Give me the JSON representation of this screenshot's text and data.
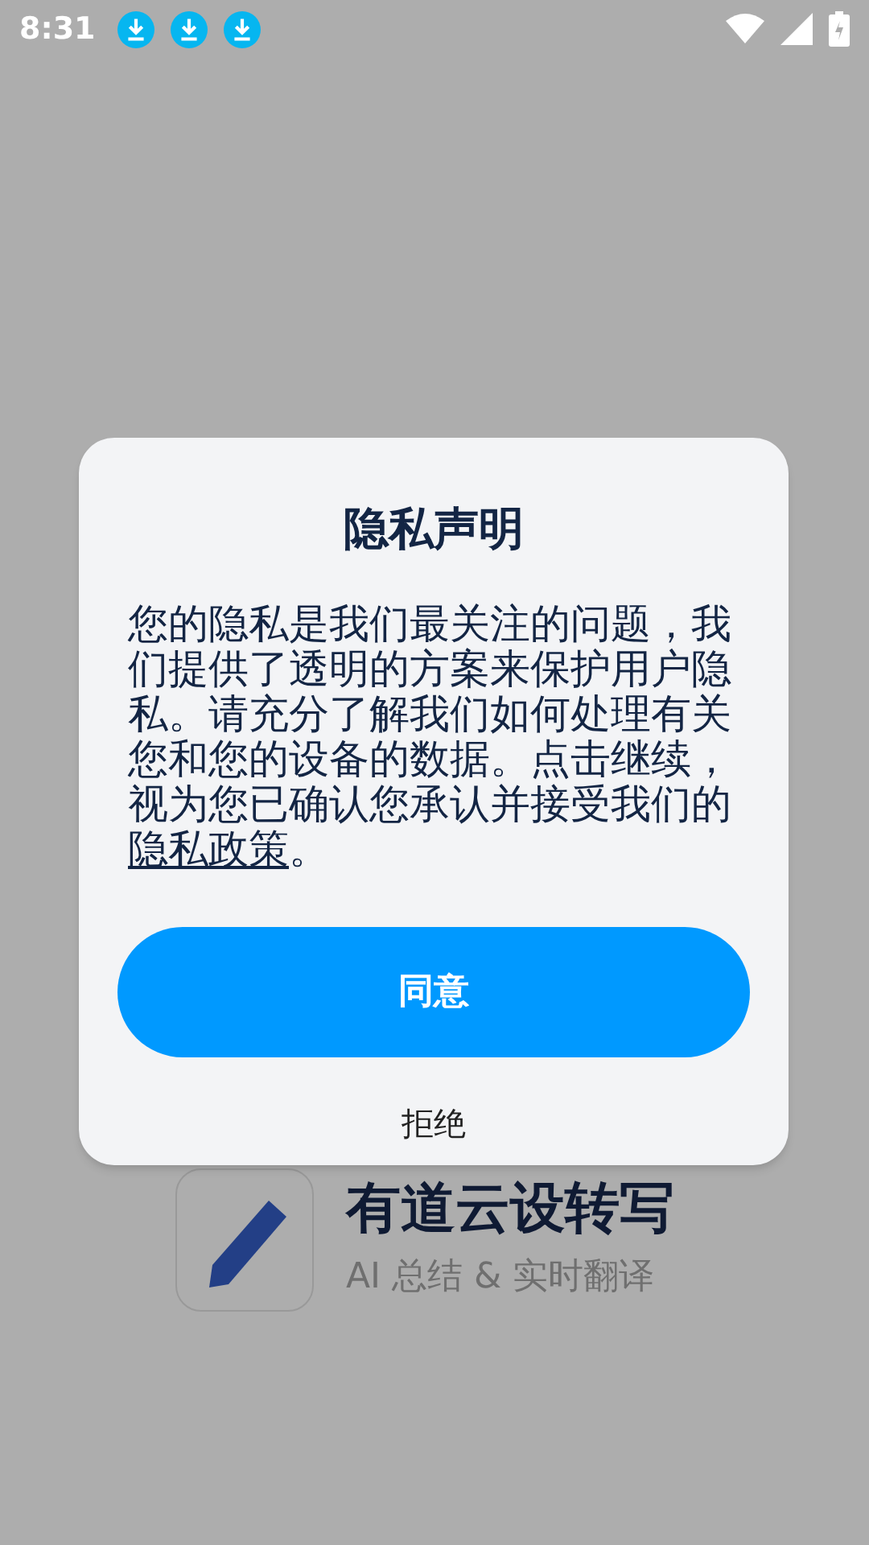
{
  "status_bar": {
    "time": "8:31",
    "notifications": [
      {
        "kind": "download"
      },
      {
        "kind": "download"
      },
      {
        "kind": "download"
      }
    ]
  },
  "background_app": {
    "title": "有道云设转写",
    "subtitle": "AI 总结 & 实时翻译"
  },
  "dialog": {
    "title": "隐私声明",
    "body": "您的隐私是我们最关注的问题，我们提供了透明的方案来保护用户隐私。请充分了解我们如何处理有关您和您的设备的数据。点击继续，视为您已确认您承认并接受我们的",
    "link": "隐私政策",
    "body_end": "。",
    "agree_button": "同意",
    "decline_button": "拒绝"
  }
}
